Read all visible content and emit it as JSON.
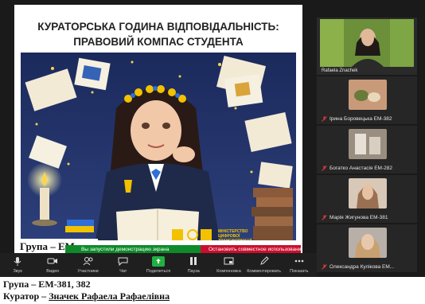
{
  "slide": {
    "title_line1": "КУРАТОРСЬКА ГОДИНА ВІДПОВІДАЛЬНІСТЬ:",
    "title_line2": "ПРАВОВИЙ КОМПАС СТУДЕНТА",
    "group_overlay": "Група – ЕМ",
    "logo_text": "МІНІСТЕРСТВО ЦИФРОВОЇ ТРАНСФОРМАЦІЇ УКРАЇНИ"
  },
  "share_bar": {
    "status": "Вы запустили демонстрацию экрана",
    "stop": "Остановить совместное использование"
  },
  "toolbar": {
    "items": [
      {
        "label": "Звук",
        "icon": "mic-icon"
      },
      {
        "label": "Видео",
        "icon": "camera-icon"
      },
      {
        "label": "Участники",
        "icon": "participants-icon"
      },
      {
        "label": "Чат",
        "icon": "chat-icon"
      },
      {
        "label": "Поделиться",
        "icon": "share-screen-icon"
      },
      {
        "label": "Пауза",
        "icon": "pause-icon"
      },
      {
        "label": "Компоновка",
        "icon": "layout-icon"
      },
      {
        "label": "Комментировать",
        "icon": "annotate-icon"
      },
      {
        "label": "Показать",
        "icon": "more-icon"
      }
    ]
  },
  "participants": {
    "main": {
      "name": "Rafaela Znachek"
    },
    "list": [
      {
        "name": "Ірина Боровецька ЕМ-382"
      },
      {
        "name": "Богатко Анастасія ЕМ-282"
      },
      {
        "name": "Марія Жигунова ЕМ-381"
      },
      {
        "name": "Олександра Кулікова ЕМ..."
      }
    ]
  },
  "caption": {
    "line1": "Група – ЕМ-381, 382",
    "line2_prefix": "Куратор  –",
    "line2_name": "Значек Рафаела Рафаелівна"
  },
  "colors": {
    "share_green": "#0e8a2a",
    "stop_red": "#c8102e",
    "toolbar_bg": "#1f1f1f",
    "panel_bg": "#1a1a1a"
  }
}
